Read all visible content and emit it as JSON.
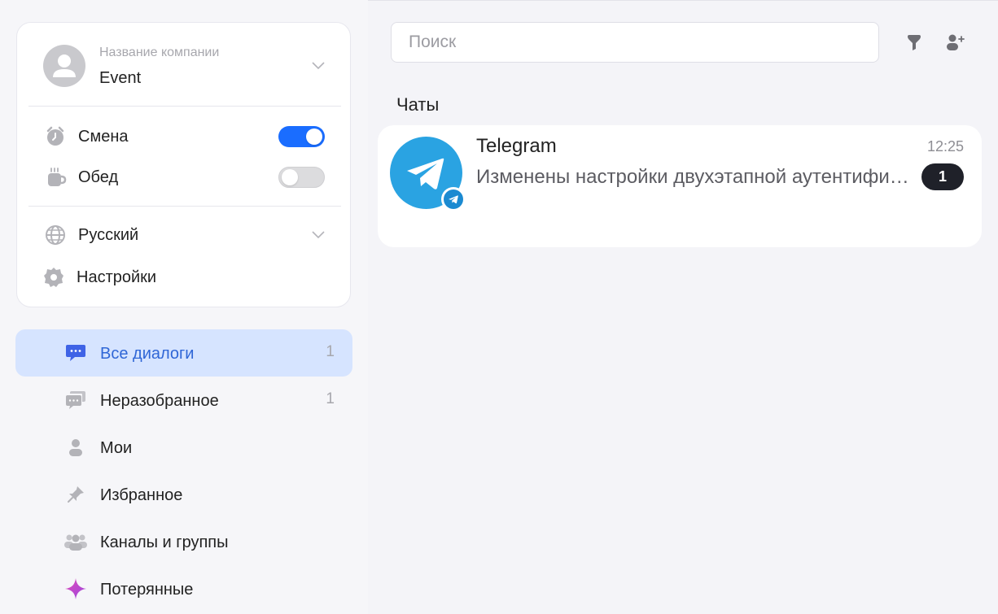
{
  "profile": {
    "company_label": "Название компании",
    "company_name": "Event"
  },
  "toggles": {
    "shift": {
      "label": "Смена",
      "on": true
    },
    "lunch": {
      "label": "Обед",
      "on": false
    }
  },
  "language": {
    "label": "Русский"
  },
  "settings": {
    "label": "Настройки"
  },
  "nav": {
    "items": [
      {
        "label": "Все диалоги",
        "count": "1",
        "icon": "chat-bubble-icon",
        "active": true
      },
      {
        "label": "Неразобранное",
        "count": "1",
        "icon": "chat-stack-icon",
        "active": false
      },
      {
        "label": "Мои",
        "count": "",
        "icon": "person-icon",
        "active": false
      },
      {
        "label": "Избранное",
        "count": "",
        "icon": "pin-icon",
        "active": false
      },
      {
        "label": "Каналы и группы",
        "count": "",
        "icon": "group-icon",
        "active": false
      },
      {
        "label": "Потерянные",
        "count": "",
        "icon": "sparkle-icon",
        "active": false
      }
    ]
  },
  "search": {
    "placeholder": "Поиск"
  },
  "chats": {
    "title": "Чаты",
    "items": [
      {
        "name": "Telegram",
        "time": "12:25",
        "preview": "Изменены настройки двухэтапной аутентификации",
        "unread": "1",
        "source": "telegram-icon"
      }
    ]
  },
  "colors": {
    "accent": "#1a6dff",
    "active_nav_bg": "#d6e4ff",
    "active_nav_text": "#2f66d6",
    "telegram": "#2aa3e2",
    "unread_badge": "#1f2129"
  }
}
